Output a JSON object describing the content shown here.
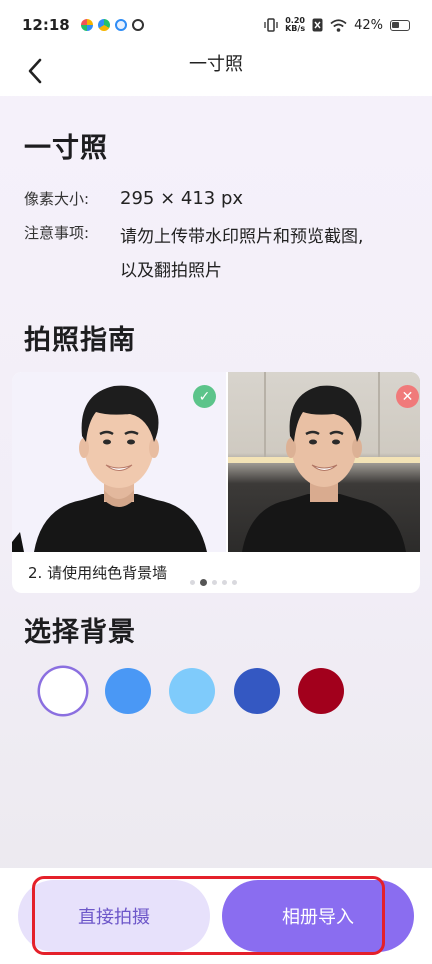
{
  "status_bar": {
    "time": "12:18",
    "net_speed_value": "0.20",
    "net_speed_unit": "KB/s",
    "battery": "42%"
  },
  "header": {
    "title": "一寸照",
    "back_icon": "chevron-left-icon"
  },
  "spec": {
    "title": "一寸照",
    "pixel_label": "像素大小:",
    "pixel_value": "295 × 413 px",
    "notes_label": "注意事项:",
    "notes_line1": "请勿上传带水印照片和预览截图,",
    "notes_line2": "以及翻拍照片"
  },
  "guide": {
    "title": "拍照指南",
    "caption": "2. 请使用纯色背景墙",
    "page_count": 5,
    "active_page": 1
  },
  "background": {
    "title": "选择背景",
    "colors": [
      "#ffffff",
      "#4a98f5",
      "#7fcbfb",
      "#3458c2",
      "#a2001c"
    ],
    "selected_index": 0
  },
  "actions": {
    "shoot_label": "直接拍摄",
    "import_label": "相册导入"
  }
}
